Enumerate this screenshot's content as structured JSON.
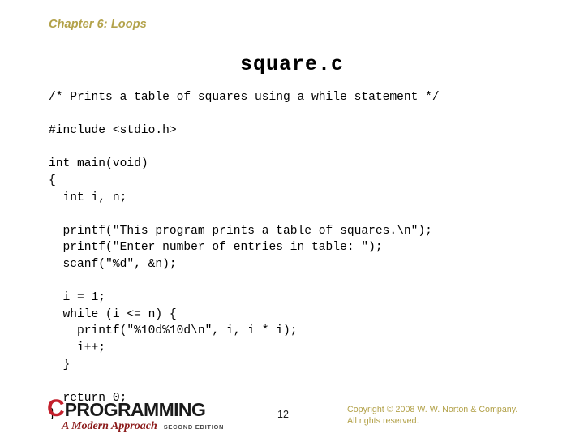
{
  "slide": {
    "chapter_header": "Chapter 6: Loops",
    "program_title": "square.c",
    "page_number": "12",
    "accent_color": "#b3a24a",
    "logo_red": "#c4202c"
  },
  "code": {
    "language": "c",
    "lines": [
      "/* Prints a table of squares using a while statement */",
      "",
      "#include <stdio.h>",
      "",
      "int main(void)",
      "{",
      "  int i, n;",
      "",
      "  printf(\"This program prints a table of squares.\\n\");",
      "  printf(\"Enter number of entries in table: \");",
      "  scanf(\"%d\", &n);",
      "",
      "  i = 1;",
      "  while (i <= n) {",
      "    printf(\"%10d%10d\\n\", i, i * i);",
      "    i++;",
      "  }",
      "",
      "  return 0;",
      "}"
    ]
  },
  "footer": {
    "logo": {
      "letter": "C",
      "word": "PROGRAMMING",
      "approach": "A Modern Approach",
      "edition": "SECOND EDITION"
    },
    "copyright_line1": "Copyright © 2008 W. W. Norton & Company.",
    "copyright_line2": "All rights reserved."
  }
}
